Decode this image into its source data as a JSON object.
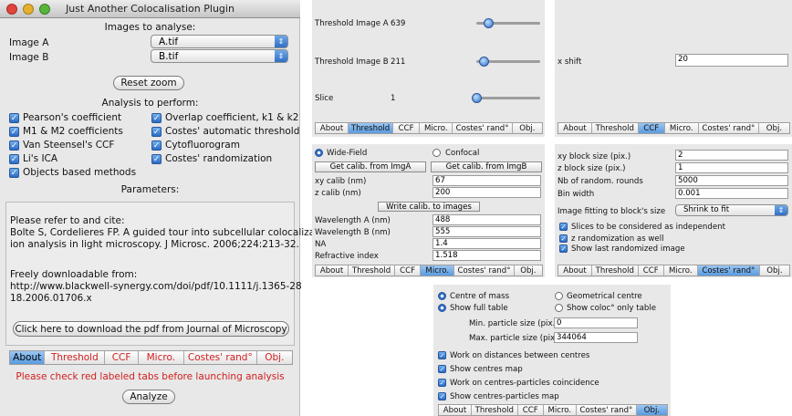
{
  "window": {
    "title": "Just Another Colocalisation Plugin"
  },
  "images": {
    "heading": "Images to analyse:",
    "a_label": "Image A",
    "a_value": "A.tif",
    "b_label": "Image B",
    "b_value": "B.tif",
    "reset_zoom": "Reset zoom"
  },
  "analysis": {
    "heading": "Analysis to perform:",
    "left": [
      "Pearson's coefficient",
      "M1 & M2 coefficients",
      "Van Steensel's CCF",
      "Li's ICA",
      "Objects based methods"
    ],
    "right": [
      "Overlap coefficient, k1 & k2",
      "Costes' automatic threshold",
      "Cytofluorogram",
      "Costes' randomization"
    ]
  },
  "parameters": {
    "heading": "Parameters:"
  },
  "citation": {
    "line1": "Please refer to and cite:",
    "line2": "Bolte S, Cordelieres FP. A guided tour into subcellular colocalizat",
    "line3": "ion  analysis in light microscopy. J Microsc. 2006;224:213-32.",
    "line4": "Freely downloadable from:",
    "line5": "http://www.blackwell-synergy.com/doi/pdf/10.1111/j.1365-28",
    "line6": "18.2006.01706.x",
    "download_button": "Click here to download the pdf from Journal of Microscopy"
  },
  "tabs": [
    "About",
    "Threshold",
    "CCF",
    "Micro.",
    "Costes' rand°",
    "Obj."
  ],
  "warning": "Please check red labeled tabs before launching analysis",
  "analyze_button": "Analyze",
  "threshold_panel": {
    "a_label": "Threshold Image A",
    "a_value": "639",
    "b_label": "Threshold Image B",
    "b_value": "211",
    "slice_label": "Slice",
    "slice_value": "1",
    "a_level": 0.14,
    "b_level": 0.05,
    "slice_level": 0.0
  },
  "ccf_panel": {
    "label": "x shift",
    "value": "20"
  },
  "micro_panel": {
    "widefield": "Wide-Field",
    "confocal": "Confocal",
    "calib_a": "Get calib. from ImgA",
    "calib_b": "Get calib. from ImgB",
    "xy_label": "xy calib (nm)",
    "xy_value": "67",
    "z_label": "z calib (nm)",
    "z_value": "200",
    "write_calib": "Write calib. to images",
    "wla_label": "Wavelength A (nm)",
    "wla_value": "488",
    "wlb_label": "Wavelength B (nm)",
    "wlb_value": "555",
    "na_label": "NA",
    "na_value": "1.4",
    "ri_label": "Refractive index",
    "ri_value": "1.518"
  },
  "costes_panel": {
    "xy_label": "xy block size (pix.)",
    "xy_value": "2",
    "z_label": "z block size (pix.)",
    "z_value": "1",
    "rounds_label": "Nb of random. rounds",
    "rounds_value": "5000",
    "bin_label": "Bin width",
    "bin_value": "0.001",
    "fit_label": "Image fitting to block's size",
    "fit_value": "Shrink to fit",
    "cb1": "Slices to be considered as independent",
    "cb2": "z randomization as well",
    "cb3": "Show last randomized image"
  },
  "obj_panel": {
    "centre_mass": "Centre of mass",
    "geo_centre": "Geometrical centre",
    "full_table": "Show full table",
    "coloc_table": "Show coloc° only table",
    "min_label": "Min. particle size (pix.)",
    "min_value": "0",
    "max_label": "Max. particle size (pix.)",
    "max_value": "344064",
    "cb1": "Work on distances between centres",
    "cb2": "Show centres map",
    "cb3": "Work on centres-particles coincidence",
    "cb4": "Show centres-particles map"
  },
  "colors": {
    "accent": "#2a6bc6",
    "warning": "#d01e1e"
  }
}
